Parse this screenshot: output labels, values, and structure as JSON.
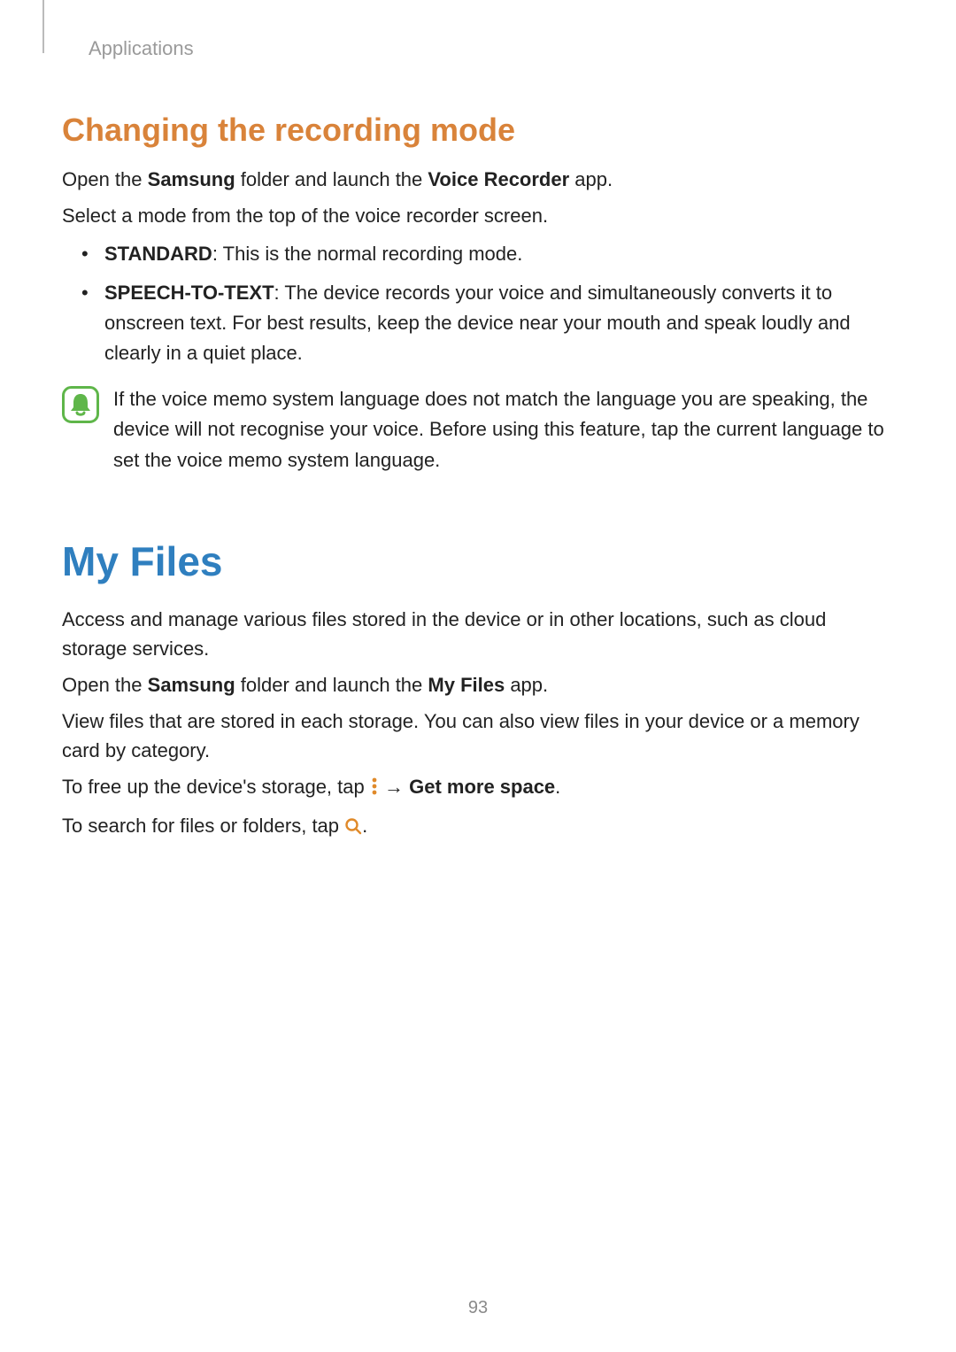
{
  "header": {
    "section": "Applications"
  },
  "section1": {
    "title": "Changing the recording mode",
    "p1_a": "Open the ",
    "p1_b": "Samsung",
    "p1_c": " folder and launch the ",
    "p1_d": "Voice Recorder",
    "p1_e": " app.",
    "p2": "Select a mode from the top of the voice recorder screen.",
    "li1_b": "STANDARD",
    "li1_t": ": This is the normal recording mode.",
    "li2_b": "SPEECH-TO-TEXT",
    "li2_t": ": The device records your voice and simultaneously converts it to onscreen text. For best results, keep the device near your mouth and speak loudly and clearly in a quiet place.",
    "note": "If the voice memo system language does not match the language you are speaking, the device will not recognise your voice. Before using this feature, tap the current language to set the voice memo system language."
  },
  "section2": {
    "title": "My Files",
    "p1": "Access and manage various files stored in the device or in other locations, such as cloud storage services.",
    "p2_a": "Open the ",
    "p2_b": "Samsung",
    "p2_c": " folder and launch the ",
    "p2_d": "My Files",
    "p2_e": " app.",
    "p3": "View files that are stored in each storage. You can also view files in your device or a memory card by category.",
    "p4_a": "To free up the device's storage, tap ",
    "p4_arrow": " → ",
    "p4_b": "Get more space",
    "p4_c": ".",
    "p5_a": "To search for files or folders, tap ",
    "p5_b": "."
  },
  "pageNumber": "93"
}
